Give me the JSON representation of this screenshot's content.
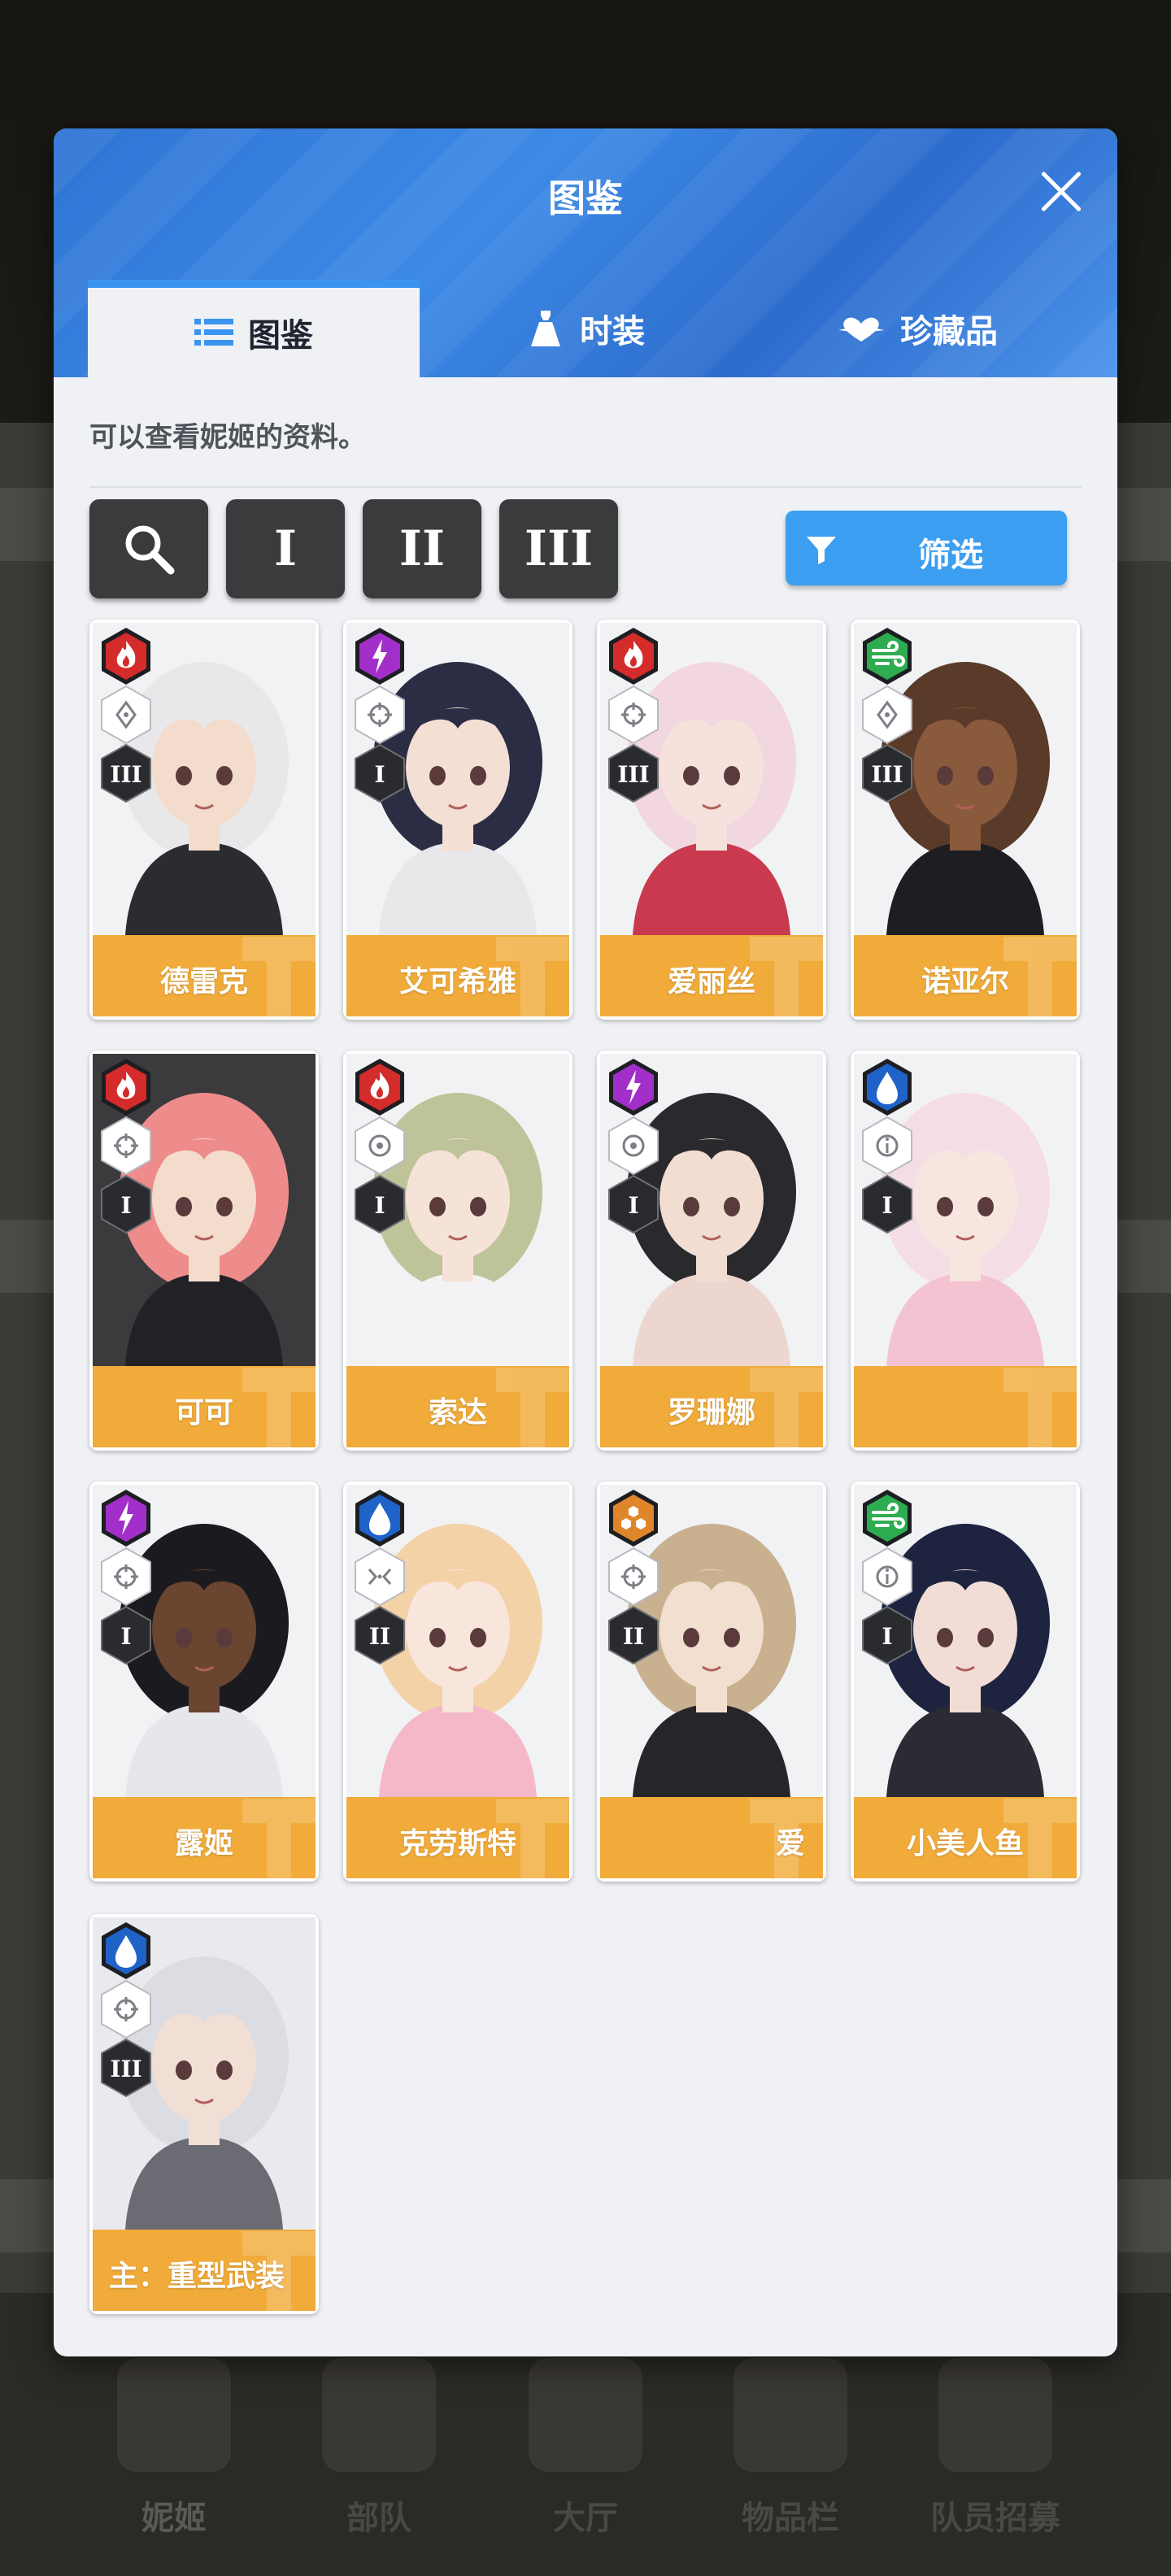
{
  "bottom_nav": [
    {
      "label": "妮姬",
      "icon": "nikke-icon",
      "active": true
    },
    {
      "label": "部队",
      "icon": "squad-icon"
    },
    {
      "label": "大厅",
      "icon": "lobby-icon"
    },
    {
      "label": "物品栏",
      "icon": "inventory-icon"
    },
    {
      "label": "队员招募",
      "icon": "recruit-icon"
    }
  ],
  "modal": {
    "title": "图鉴",
    "tabs": [
      {
        "label": "图鉴",
        "icon": "list-icon",
        "active": true
      },
      {
        "label": "时装",
        "icon": "dress-icon"
      },
      {
        "label": "珍藏品",
        "icon": "treasure-icon"
      }
    ],
    "description": "可以查看妮姬的资料。",
    "toolbar": {
      "burst_filters": [
        "I",
        "II",
        "III"
      ],
      "filter_label": "筛选"
    }
  },
  "colors": {
    "fire": "#d42b2b",
    "electric": "#a22fc9",
    "wind": "#2dac50",
    "water": "#1f63c9",
    "iron": "#e0862a",
    "namebar": "#f1ab3a",
    "accent": "#3b9ef0"
  },
  "characters": [
    {
      "name": "德雷克",
      "element": "fire",
      "weapon": "crosshair",
      "burst": "III",
      "hair": "#e8e8ea",
      "skin": "#f4dccd",
      "outfit": "#2b2b30",
      "bg": "#f1f2f4"
    },
    {
      "name": "艾可希雅",
      "element": "electric",
      "weapon": "sniper",
      "burst": "I",
      "hair": "#2b2d44",
      "skin": "#f3dfd4",
      "outfit": "#e8e8ea",
      "bg": "#f1f2f4"
    },
    {
      "name": "爱丽丝",
      "element": "fire",
      "weapon": "sniper",
      "burst": "III",
      "hair": "#f2d6e0",
      "skin": "#f6e1dc",
      "outfit": "#c93a4e",
      "bg": "#f1f2f4"
    },
    {
      "name": "诺亚尔",
      "element": "wind",
      "weapon": "crosshair",
      "burst": "III",
      "hair": "#5a3a28",
      "skin": "#8a5a3c",
      "outfit": "#1e1e22",
      "bg": "#f1f2f4"
    },
    {
      "name": "可可",
      "element": "fire",
      "weapon": "sniper",
      "burst": "I",
      "hair": "#ee8c8c",
      "skin": "#f4dccd",
      "outfit": "#222226",
      "bg": "#3b3b3d"
    },
    {
      "name": "索达",
      "element": "fire",
      "weapon": "ring",
      "burst": "I",
      "hair": "#bfc39a",
      "skin": "#f6e3d8",
      "outfit": "#f3f3f3",
      "bg": "#f1f2f4"
    },
    {
      "name": "罗珊娜",
      "element": "electric",
      "weapon": "ring",
      "burst": "I",
      "hair": "#2a2a2e",
      "skin": "#f2ddd3",
      "outfit": "#ecd6cf",
      "bg": "#f1f2f4"
    },
    {
      "name": "",
      "element": "water",
      "weapon": "info",
      "burst": "I",
      "hair": "#f5dde6",
      "skin": "#f7e5e0",
      "outfit": "#f4c3d1",
      "bg": "#f1f2f4"
    },
    {
      "name": "露姬",
      "element": "electric",
      "weapon": "sniper",
      "burst": "I",
      "hair": "#1b1b1f",
      "skin": "#6a4530",
      "outfit": "#e6e7ea",
      "bg": "#f1f2f4"
    },
    {
      "name": "克劳斯特",
      "element": "water",
      "weapon": "shotgun",
      "burst": "II",
      "hair": "#f3d2a8",
      "skin": "#f8e5dc",
      "outfit": "#f4b8c8",
      "bg": "#f1f2f4"
    },
    {
      "name": "爱",
      "element": "iron",
      "weapon": "sniper",
      "burst": "II",
      "hair": "#c9b08f",
      "skin": "#f3dfd0",
      "outfit": "#26262a",
      "bg": "#f1f2f4"
    },
    {
      "name": "小美人鱼",
      "element": "wind",
      "weapon": "info",
      "burst": "I",
      "hair": "#1e2440",
      "skin": "#f1ddd5",
      "outfit": "#2a2b33",
      "bg": "#f1f2f4"
    },
    {
      "name": "主：重型武装",
      "element": "water",
      "weapon": "sniper",
      "burst": "III",
      "hair": "#dcdde2",
      "skin": "#f1dfd6",
      "outfit": "#6a6b73",
      "bg": "#e9eaee"
    }
  ]
}
